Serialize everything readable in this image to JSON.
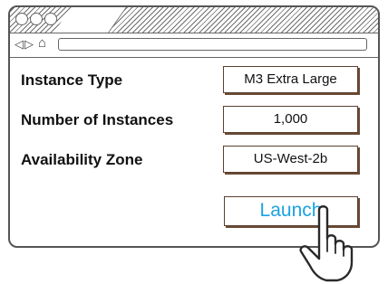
{
  "browser": {
    "back_icon": "back-arrow-icon",
    "forward_icon": "forward-arrow-icon",
    "home_icon": "home-icon",
    "address_value": ""
  },
  "form": {
    "rows": [
      {
        "label": "Instance Type",
        "value": "M3 Extra Large"
      },
      {
        "label": "Number of Instances",
        "value": "1,000"
      },
      {
        "label": "Availability Zone",
        "value": "US-West-2b"
      }
    ],
    "launch_label": "Launch"
  },
  "colors": {
    "launch_text": "#1aa3e0",
    "field_border": "#5a4030"
  },
  "cursor_icon": "hand-pointer-icon"
}
